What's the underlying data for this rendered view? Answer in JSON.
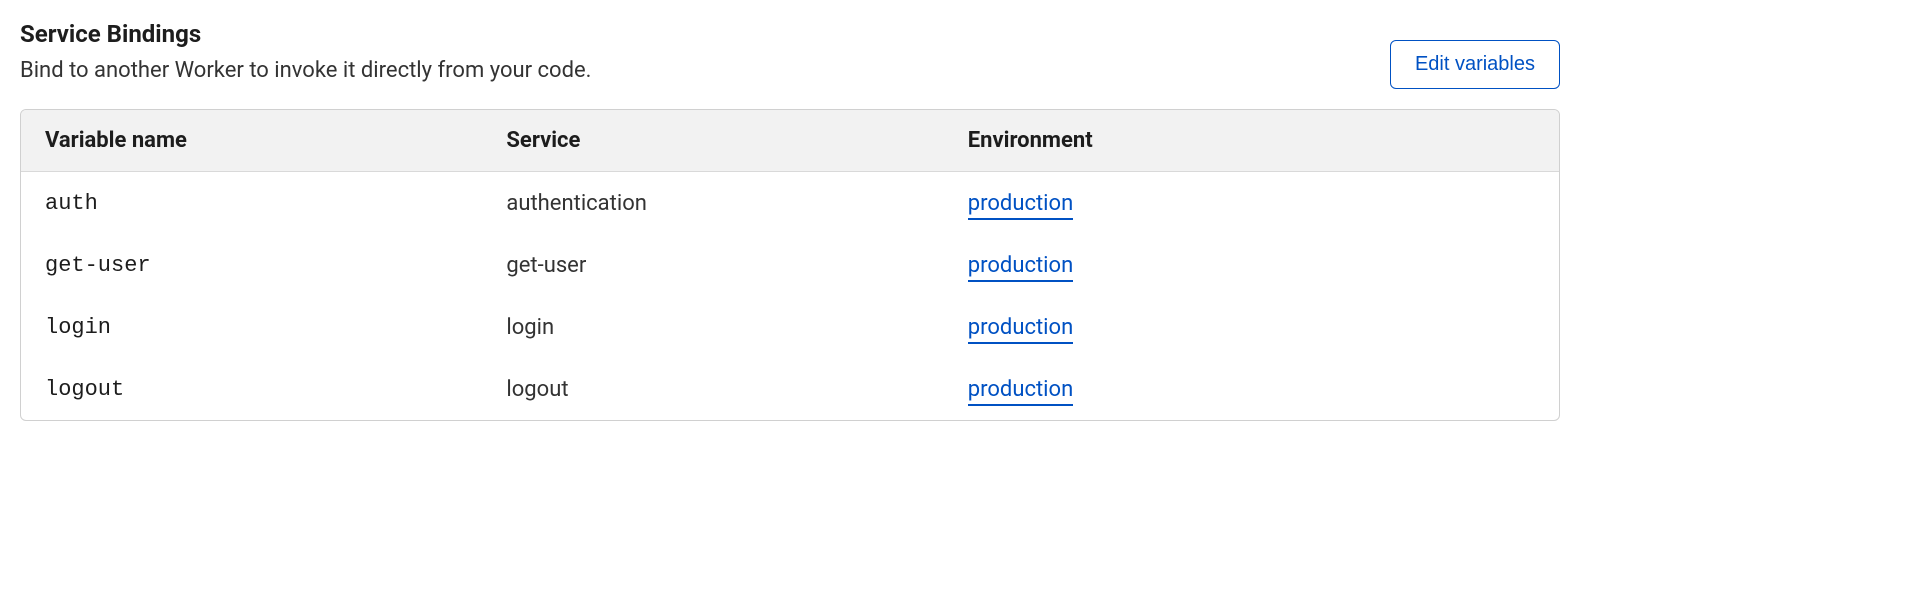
{
  "section": {
    "title": "Service Bindings",
    "description": "Bind to another Worker to invoke it directly from your code.",
    "edit_button_label": "Edit variables"
  },
  "table": {
    "headers": {
      "variable_name": "Variable name",
      "service": "Service",
      "environment": "Environment"
    },
    "rows": [
      {
        "variable_name": "auth",
        "service": "authentication",
        "environment": "production"
      },
      {
        "variable_name": "get-user",
        "service": "get-user",
        "environment": "production"
      },
      {
        "variable_name": "login",
        "service": "login",
        "environment": "production"
      },
      {
        "variable_name": "logout",
        "service": "logout",
        "environment": "production"
      }
    ]
  }
}
